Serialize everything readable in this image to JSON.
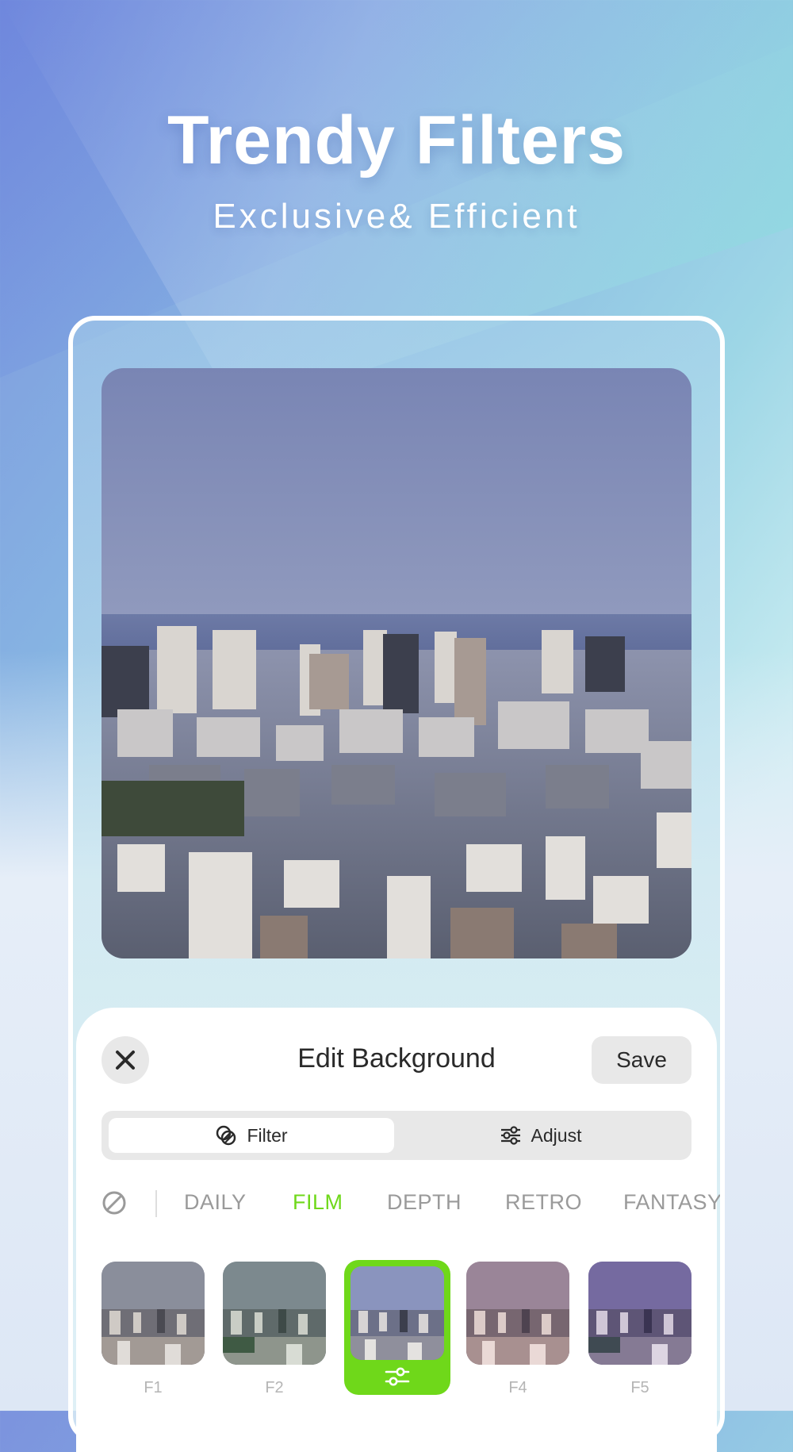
{
  "hero": {
    "title": "Trendy Filters",
    "subtitle": "Exclusive& Efficient"
  },
  "editor": {
    "title": "Edit Background",
    "save_label": "Save",
    "close_icon": "close-icon"
  },
  "tabs": [
    {
      "label": "Filter",
      "icon": "filter-icon",
      "active": true
    },
    {
      "label": "Adjust",
      "icon": "sliders-icon",
      "active": false
    }
  ],
  "categories": {
    "none_icon": "no-filter-icon",
    "items": [
      {
        "label": "DAILY",
        "active": false
      },
      {
        "label": "FILM",
        "active": true
      },
      {
        "label": "DEPTH",
        "active": false
      },
      {
        "label": "RETRO",
        "active": false
      },
      {
        "label": "FANTASY",
        "active": false
      }
    ]
  },
  "filters": [
    {
      "label": "F1",
      "selected": false
    },
    {
      "label": "F2",
      "selected": false
    },
    {
      "label": "",
      "selected": true,
      "icon": "adjust-sliders-icon"
    },
    {
      "label": "F4",
      "selected": false
    },
    {
      "label": "F5",
      "selected": false
    }
  ],
  "colors": {
    "accent": "#6fd81a",
    "sheet": "#ffffff",
    "control_bg": "#e8e8e8",
    "text_primary": "#2a2a2a",
    "text_muted": "#9a9a9a"
  }
}
